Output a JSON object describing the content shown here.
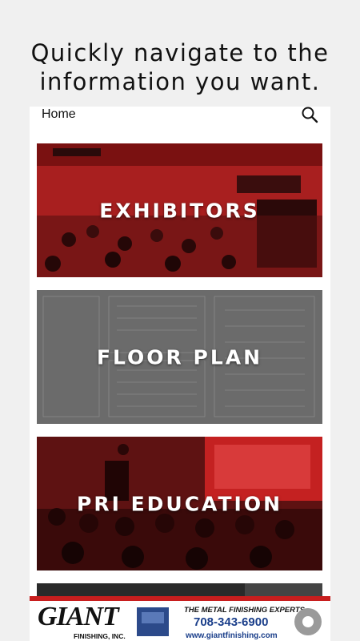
{
  "headline": {
    "line1": "Quickly navigate to the",
    "line2": "information you want."
  },
  "appbar": {
    "title": "Home",
    "search_icon": "search-icon"
  },
  "tiles": [
    {
      "label": "EXHIBITORS",
      "image": "trade-show-crowd-photo",
      "tint": "#c41e1e"
    },
    {
      "label": "FLOOR PLAN",
      "image": "floor-plan-map",
      "tint": "#5e5e5e"
    },
    {
      "label": "PRI EDUCATION",
      "image": "seminar-audience-photo",
      "tint": "#b01a1a"
    },
    {
      "label": "",
      "image": "partial-tile-photo",
      "tint": "#2a2a2a"
    }
  ],
  "ad": {
    "brand": "GIANT",
    "brand_sub": "FINISHING, INC.",
    "tagline": "THE METAL FINISHING EXPERTS",
    "phone": "708-343-6900",
    "website": "www.giantfinishing.com",
    "accent": "#c81e1e",
    "text_blue": "#1a3e8a"
  }
}
